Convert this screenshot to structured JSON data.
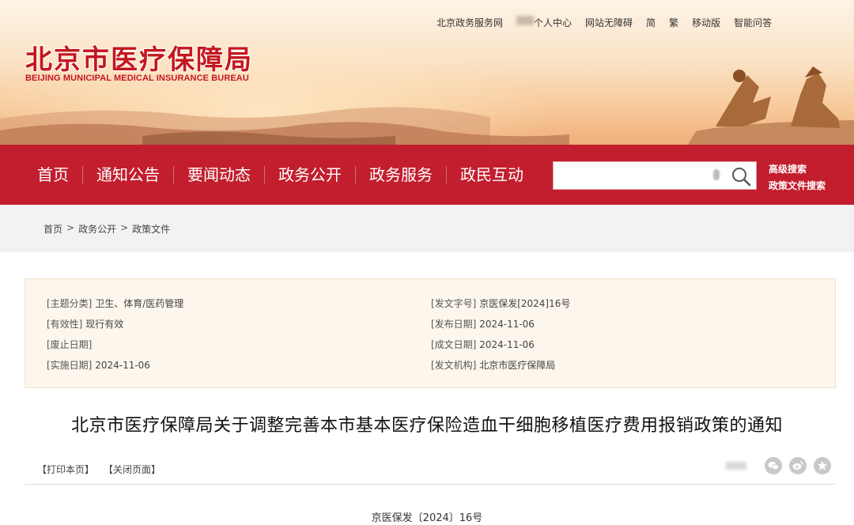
{
  "header": {
    "logo_cn": "北京市医疗保障局",
    "logo_en": "BEIJING MUNICIPAL MEDICAL INSURANCE BUREAU",
    "top_links": {
      "gov_service": "北京政务服务网",
      "personal_center": "个人中心",
      "accessibility": "网站无障碍",
      "simplified": "简",
      "traditional": "繁",
      "mobile": "移动版",
      "qa": "智能问答"
    }
  },
  "nav": {
    "items": [
      "首页",
      "通知公告",
      "要闻动态",
      "政务公开",
      "政务服务",
      "政民互动"
    ],
    "advanced_search": "高级搜索",
    "policy_search": "政策文件搜索"
  },
  "breadcrumb": {
    "home": "首页",
    "level2": "政务公开",
    "level3": "政策文件",
    "separator": ">"
  },
  "meta": {
    "topic_key": "[主题分类]",
    "topic_value": "卫生、体育/医药管理",
    "validity_key": "[有效性]",
    "validity_value": "现行有效",
    "abolish_key": "[废止日期]",
    "abolish_value": "",
    "effective_key": "[实施日期]",
    "effective_value": "2024-11-06",
    "docno_key": "[发文字号]",
    "docno_value": "京医保发[2024]16号",
    "publish_key": "[发布日期]",
    "publish_value": "2024-11-06",
    "written_key": "[成文日期]",
    "written_value": "2024-11-06",
    "issuer_key": "[发文机构]",
    "issuer_value": "北京市医疗保障局"
  },
  "document": {
    "title": "北京市医疗保障局关于调整完善本市基本医疗保险造血干细胞移植医疗费用报销政策的通知",
    "print": "【打印本页】",
    "close": "【关闭页面】",
    "doc_number": "京医保发〔2024〕16号"
  },
  "colors": {
    "brand_red": "#c21e2d",
    "logo_red": "#c5171f",
    "meta_bg": "#fcf6ec"
  }
}
